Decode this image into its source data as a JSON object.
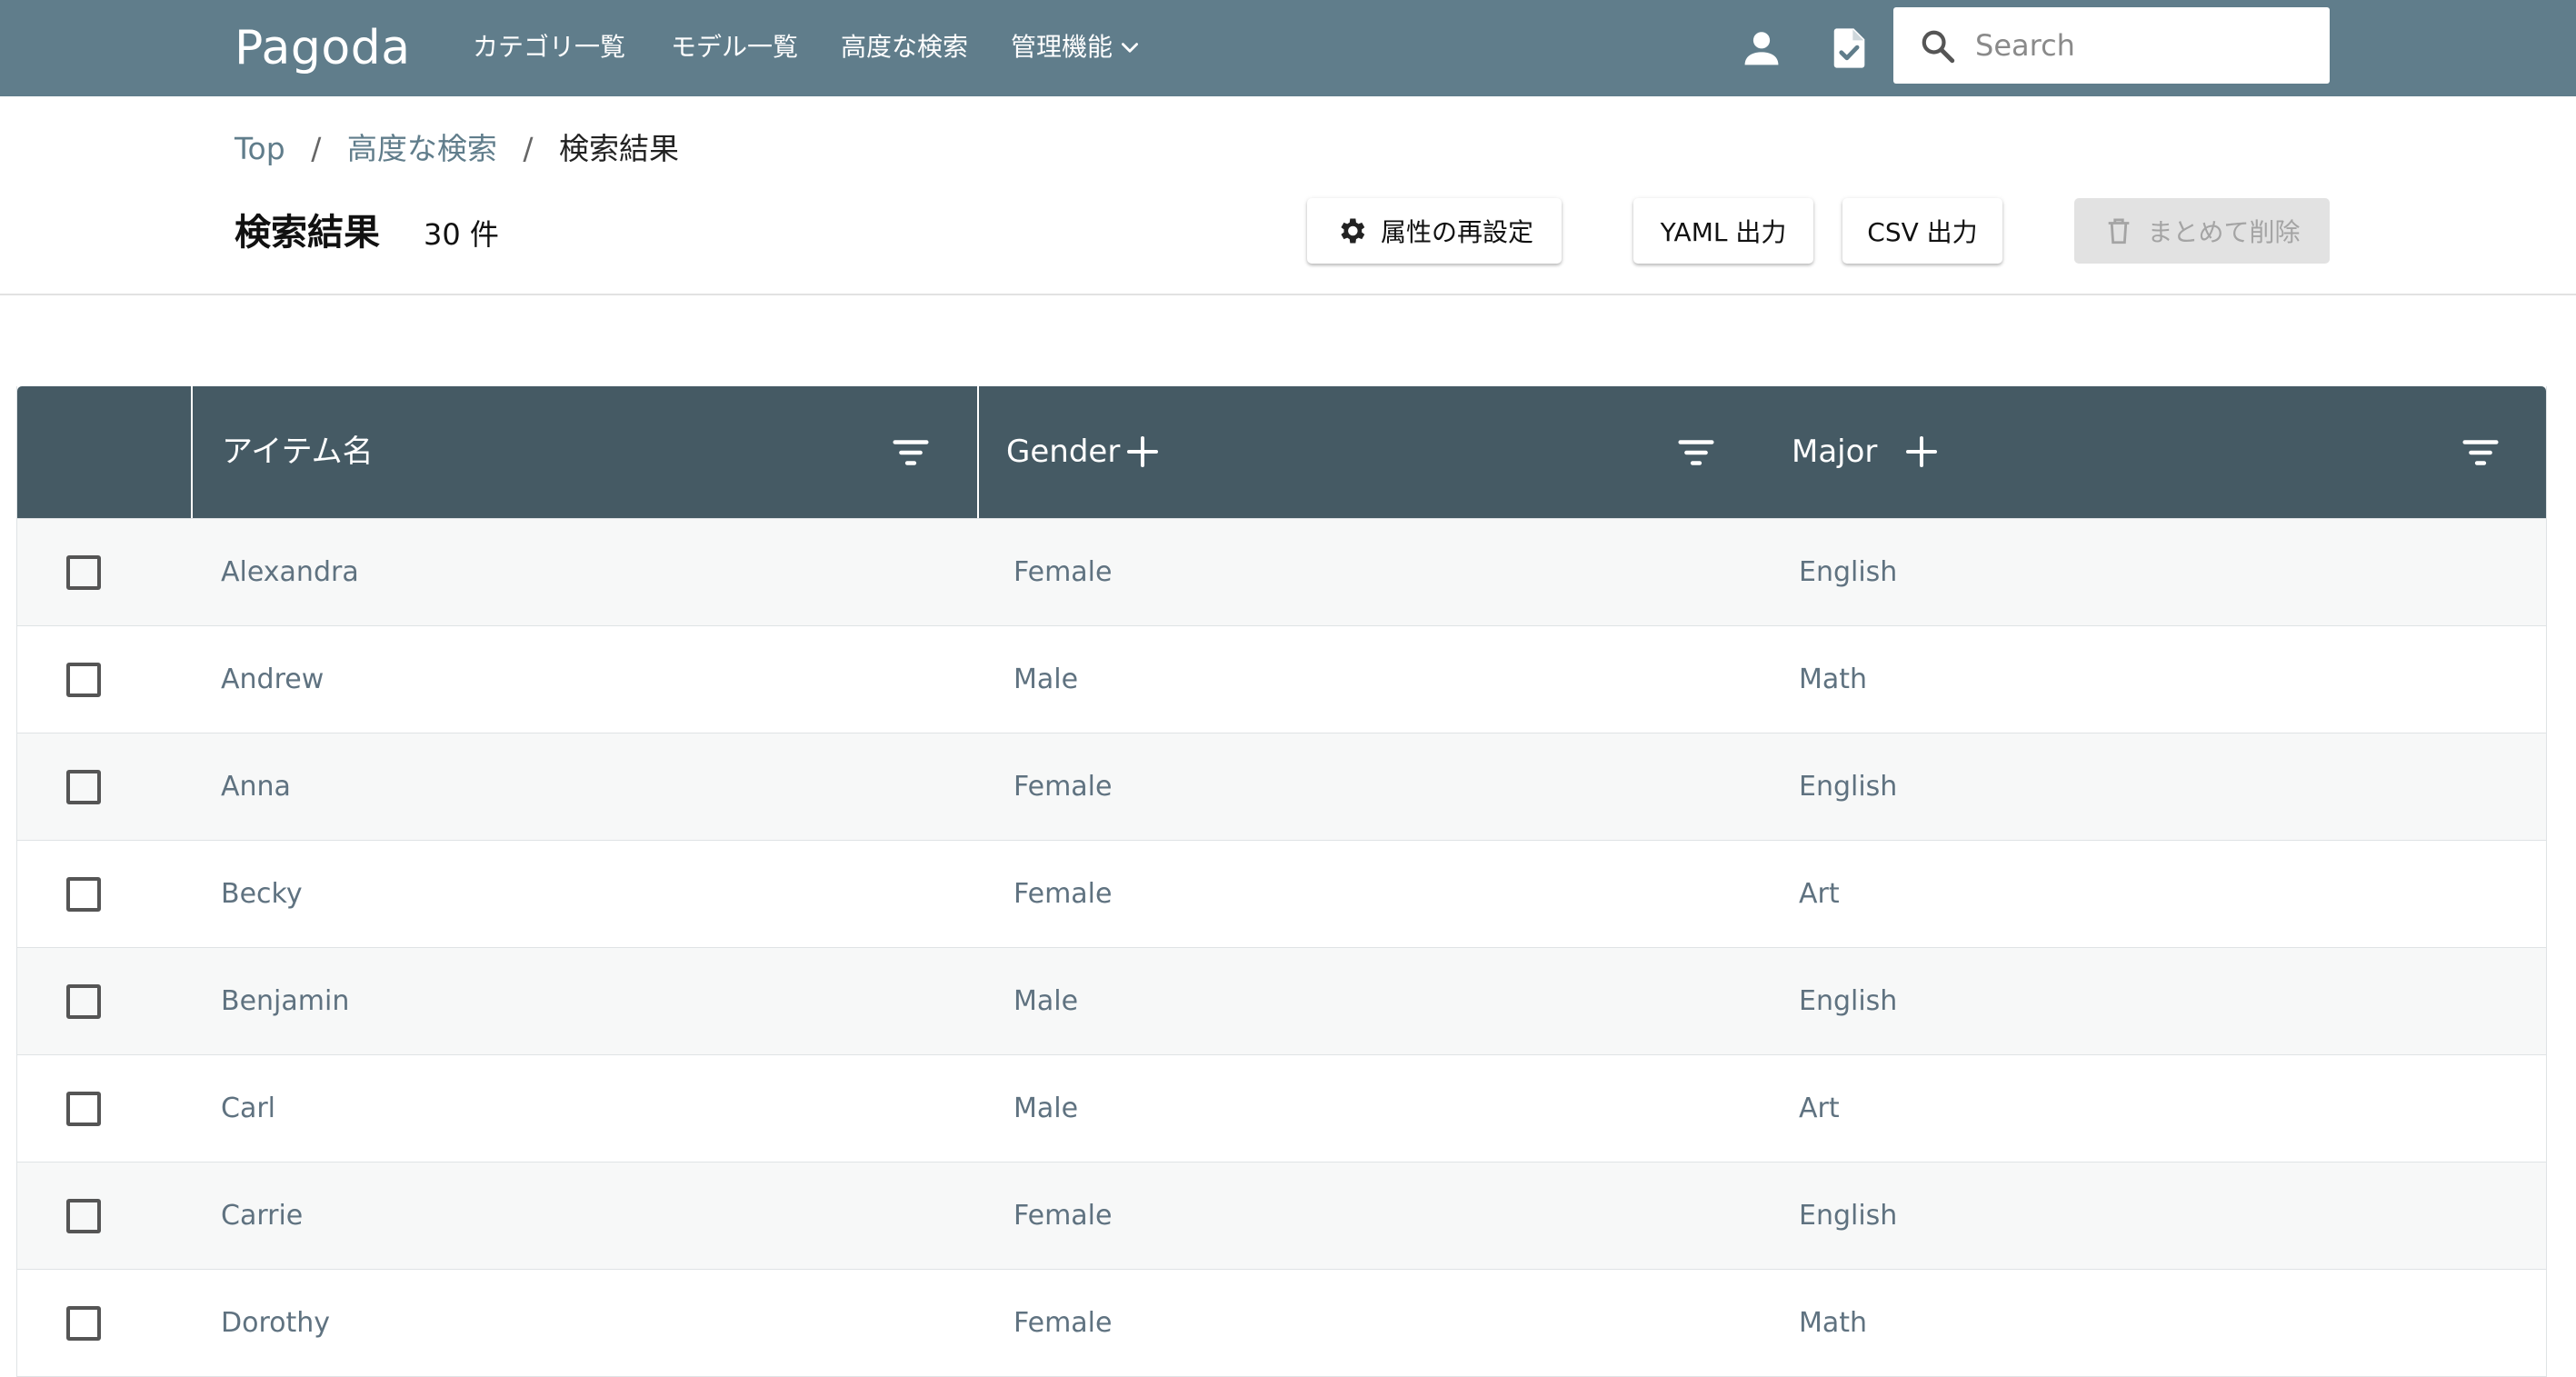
{
  "appbar": {
    "brand": "Pagoda",
    "nav": [
      "カテゴリ一覧",
      "モデル一覧",
      "高度な検索",
      "管理機能"
    ],
    "icons": [
      "user-icon",
      "job-status-icon"
    ],
    "search": {
      "placeholder": "Search",
      "value": ""
    },
    "color": "#607d8b"
  },
  "breadcrumb": {
    "items": [
      "Top",
      "高度な検索"
    ],
    "current": "検索結果",
    "separator": "/"
  },
  "header": {
    "title": "検索結果",
    "count": "30 件"
  },
  "toolbar": {
    "reset_attrs": "属性の再設定",
    "yaml_export": "YAML 出力",
    "csv_export": "CSV 出力",
    "bulk_delete": "まとめて削除"
  },
  "table": {
    "header_color": "#455a64",
    "columns": [
      "アイテム名",
      "Gender",
      "Major"
    ],
    "rows": [
      [
        "Alexandra",
        "Female",
        "English"
      ],
      [
        "Andrew",
        "Male",
        "Math"
      ],
      [
        "Anna",
        "Female",
        "English"
      ],
      [
        "Becky",
        "Female",
        "Art"
      ],
      [
        "Benjamin",
        "Male",
        "English"
      ],
      [
        "Carl",
        "Male",
        "Art"
      ],
      [
        "Carrie",
        "Female",
        "English"
      ],
      [
        "Dorothy",
        "Female",
        "Math"
      ]
    ]
  }
}
